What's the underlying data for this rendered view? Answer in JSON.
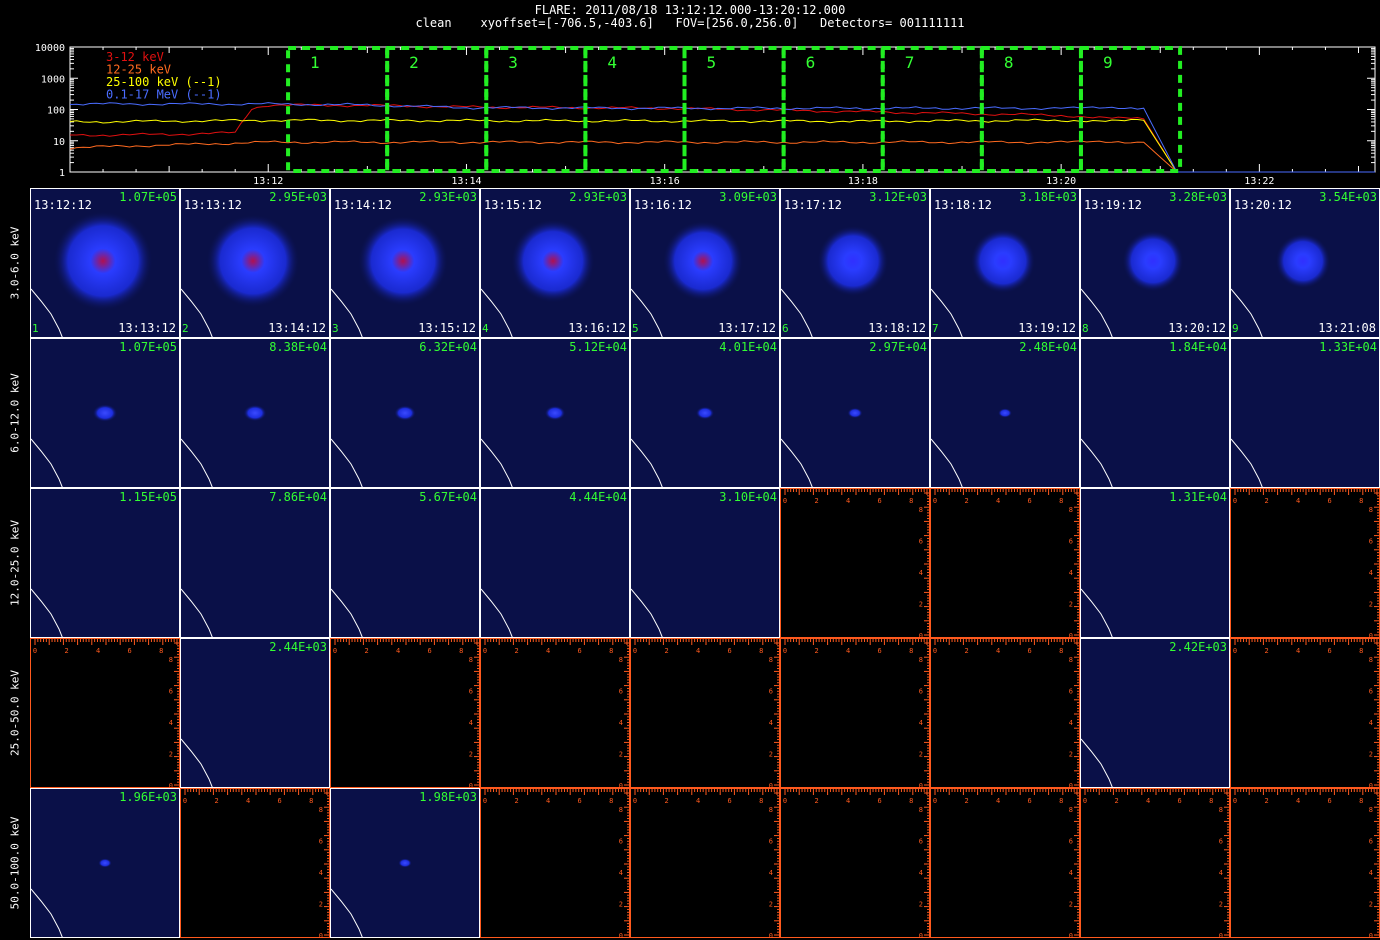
{
  "header": {
    "title": "FLARE: 2011/08/18 13:12:12.000-13:20:12.000",
    "subtitle": "clean    xyoffset=[-706.5,-403.6]   FOV=[256.0,256.0]   Detectors= 001111111"
  },
  "chart_data": [
    {
      "type": "line",
      "scale": "log",
      "ylim": [
        1,
        10000
      ],
      "yticks": [
        "10000",
        "1000",
        "100",
        "10",
        "1"
      ],
      "xtick_labels": [
        "13:12",
        "13:14",
        "13:16",
        "13:18",
        "13:20",
        "13:22"
      ],
      "series": [
        {
          "name": "3-12 keV",
          "color": "#e01010",
          "x": [
            "13:10:00",
            "13:11:00",
            "13:11:40",
            "13:11:50",
            "13:12:00",
            "13:13:00",
            "13:14:00",
            "13:16:00",
            "13:18:00",
            "13:20:00",
            "13:20:50",
            "13:21:10"
          ],
          "values": [
            15,
            16,
            18,
            100,
            140,
            135,
            120,
            110,
            85,
            65,
            50,
            1
          ]
        },
        {
          "name": "12-25 keV",
          "color": "#ff6a20",
          "x": [
            "13:10:00",
            "13:12:00",
            "13:14:00",
            "13:16:00",
            "13:18:00",
            "13:20:00",
            "13:20:50",
            "13:21:10"
          ],
          "values": [
            6,
            9,
            9,
            9,
            9,
            9,
            9,
            1
          ]
        },
        {
          "name": "25-100 keV (--1)",
          "color": "#ffff00",
          "x": [
            "13:10:00",
            "13:12:00",
            "13:14:00",
            "13:16:00",
            "13:18:00",
            "13:20:00",
            "13:20:50",
            "13:21:10"
          ],
          "values": [
            40,
            45,
            44,
            43,
            42,
            45,
            45,
            1
          ]
        },
        {
          "name": "0.1-17 MeV (--1)",
          "color": "#4a6cff",
          "x": [
            "13:10:00",
            "13:12:00",
            "13:13:00",
            "13:14:00",
            "13:16:00",
            "13:18:00",
            "13:20:00",
            "13:20:50",
            "13:21:10",
            "13:23:00"
          ],
          "values": [
            150,
            150,
            140,
            115,
            110,
            110,
            110,
            110,
            1,
            1
          ]
        }
      ],
      "intervals": [
        "1",
        "2",
        "3",
        "4",
        "5",
        "6",
        "7",
        "8",
        "9"
      ],
      "grid": false
    },
    {
      "type": "heatmap",
      "row_labels": [
        "3.0-6.0 keV",
        "6.0-12.0 keV",
        "12.0-25.0 keV",
        "25.0-50.0 keV",
        "50.0-100.0 keV"
      ],
      "start_times": [
        "13:12:12",
        "13:13:12",
        "13:14:12",
        "13:15:12",
        "13:16:12",
        "13:17:12",
        "13:18:12",
        "13:19:12",
        "13:20:12"
      ],
      "end_times": [
        "13:13:12",
        "13:14:12",
        "13:15:12",
        "13:16:12",
        "13:17:12",
        "13:18:12",
        "13:19:12",
        "13:20:12",
        "13:21:08"
      ],
      "interval_numbers": [
        "1",
        "2",
        "3",
        "4",
        "5",
        "6",
        "7",
        "8",
        "9"
      ],
      "panel_axis_ticks": [
        "0",
        "2",
        "4",
        "6",
        "8"
      ],
      "peaks": [
        [
          "1.07E+05",
          "2.95E+03",
          "2.93E+03",
          "2.93E+03",
          "3.09E+03",
          "3.12E+03",
          "3.18E+03",
          "3.28E+03",
          "3.54E+03"
        ],
        [
          "1.07E+05",
          "8.38E+04",
          "6.32E+04",
          "5.12E+04",
          "4.01E+04",
          "2.97E+04",
          "2.48E+04",
          "1.84E+04",
          "1.33E+04"
        ],
        [
          "1.15E+05",
          "7.86E+04",
          "5.67E+04",
          "4.44E+04",
          "3.10E+04",
          "",
          "",
          "1.31E+04",
          ""
        ],
        [
          "",
          "2.44E+03",
          "",
          "",
          "",
          "",
          "",
          "2.42E+03",
          ""
        ],
        [
          "1.96E+03",
          "",
          "1.98E+03",
          "",
          "",
          "",
          "",
          "",
          ""
        ]
      ],
      "source_intensity": [
        [
          1.0,
          0.9,
          0.85,
          0.75,
          0.7,
          0.55,
          0.45,
          0.4,
          0.3
        ],
        [
          0.8,
          0.7,
          0.6,
          0.55,
          0.4,
          0.2,
          0.12,
          0,
          0
        ],
        [
          0,
          0,
          0,
          0,
          0,
          0,
          0,
          0,
          0
        ],
        [
          0,
          0,
          0,
          0,
          0,
          0,
          0,
          0,
          0
        ],
        [
          0.1,
          0,
          0.1,
          0,
          0,
          0,
          0,
          0,
          0
        ]
      ]
    }
  ]
}
